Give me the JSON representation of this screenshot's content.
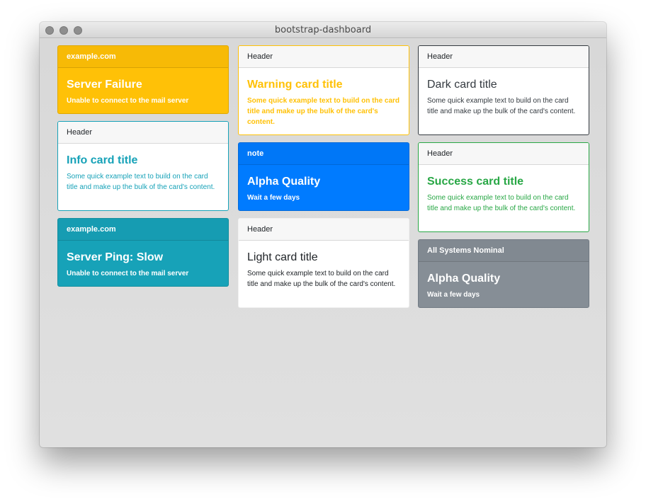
{
  "window": {
    "title": "bootstrap-dashboard"
  },
  "cards": {
    "server_failure": {
      "header": "example.com",
      "title": "Server Failure",
      "text": "Unable to connect to the mail server"
    },
    "info": {
      "header": "Header",
      "title": "Info card title",
      "text": "Some quick example text to build on the card title and make up the bulk of the card's content."
    },
    "server_ping": {
      "header": "example.com",
      "title": "Server Ping: Slow",
      "text": "Unable to connect to the mail server"
    },
    "warning": {
      "header": "Header",
      "title": "Warning card title",
      "text": "Some quick example text to build on the card title and make up the bulk of the card's content."
    },
    "alpha_note": {
      "header": "note",
      "title": "Alpha Quality",
      "text": "Wait a few days"
    },
    "light": {
      "header": "Header",
      "title": "Light card title",
      "text": "Some quick example text to build on the card title and make up the bulk of the card's content."
    },
    "dark": {
      "header": "Header",
      "title": "Dark card title",
      "text": "Some quick example text to build on the card title and make up the bulk of the card's content."
    },
    "success": {
      "header": "Header",
      "title": "Success card title",
      "text": "Some quick example text to build on the card title and make up the bulk of the card's content."
    },
    "systems": {
      "header": "All Systems Nominal",
      "title": "Alpha Quality",
      "text": "Wait a few days"
    }
  },
  "colors": {
    "warning": "#ffc107",
    "info": "#17a2b8",
    "primary": "#007bff",
    "success": "#28a745",
    "dark": "#343a40",
    "secondary": "#868e96"
  }
}
